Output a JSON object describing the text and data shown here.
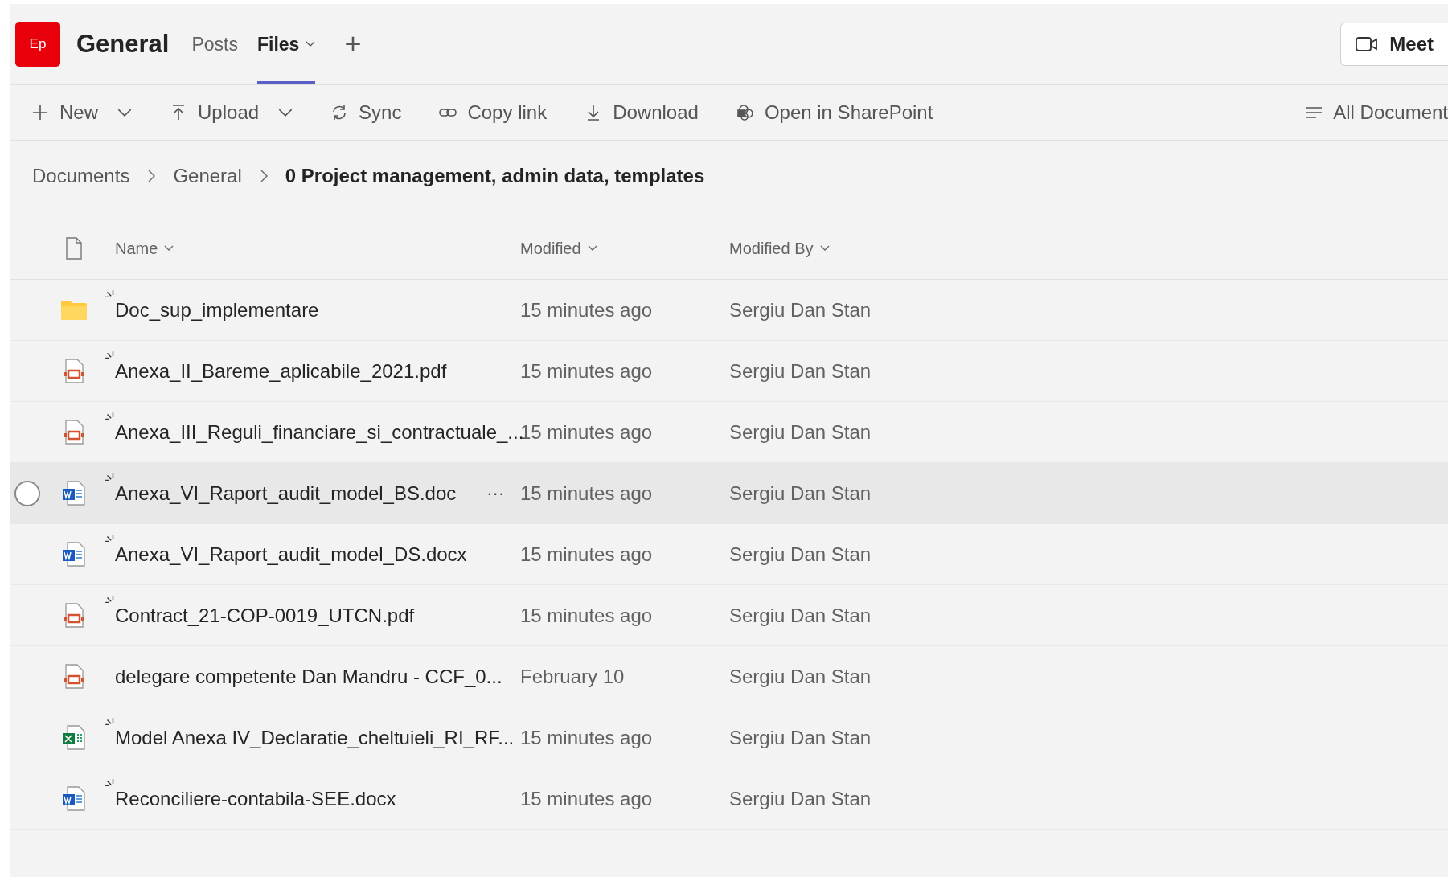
{
  "header": {
    "team_initials": "Ep",
    "channel": "General",
    "tabs": [
      {
        "label": "Posts",
        "selected": false,
        "dropdown": false
      },
      {
        "label": "Files",
        "selected": true,
        "dropdown": true
      }
    ],
    "add_tab": "+",
    "meet_button": "Meet"
  },
  "toolbar": {
    "actions": [
      {
        "label": "New",
        "kind": "new",
        "dropdown": true
      },
      {
        "label": "Upload",
        "kind": "upload",
        "dropdown": true
      },
      {
        "label": "Sync",
        "kind": "sync",
        "dropdown": false
      },
      {
        "label": "Copy link",
        "kind": "link",
        "dropdown": false
      },
      {
        "label": "Download",
        "kind": "download",
        "dropdown": false
      },
      {
        "label": "Open in SharePoint",
        "kind": "sharepoint",
        "dropdown": false
      }
    ],
    "view": "All Document"
  },
  "breadcrumb": [
    "Documents",
    "General",
    "0 Project management, admin data, templates"
  ],
  "table": {
    "columns": [
      "Name",
      "Modified",
      "Modified By"
    ],
    "more_label": "···",
    "rows": [
      {
        "kind": "folder",
        "name": "Doc_sup_implementare",
        "new": true,
        "hovered": false,
        "modified": "15 minutes ago",
        "modified_by": "Sergiu Dan Stan"
      },
      {
        "kind": "pdf",
        "name": "Anexa_II_Bareme_aplicabile_2021.pdf",
        "new": true,
        "hovered": false,
        "modified": "15 minutes ago",
        "modified_by": "Sergiu Dan Stan"
      },
      {
        "kind": "pdf",
        "name": "Anexa_III_Reguli_financiare_si_contractuale_...",
        "new": true,
        "hovered": false,
        "modified": "15 minutes ago",
        "modified_by": "Sergiu Dan Stan"
      },
      {
        "kind": "word",
        "name": "Anexa_VI_Raport_audit_model_BS.doc",
        "new": true,
        "hovered": true,
        "modified": "15 minutes ago",
        "modified_by": "Sergiu Dan Stan"
      },
      {
        "kind": "word",
        "name": "Anexa_VI_Raport_audit_model_DS.docx",
        "new": true,
        "hovered": false,
        "modified": "15 minutes ago",
        "modified_by": "Sergiu Dan Stan"
      },
      {
        "kind": "pdf",
        "name": "Contract_21-COP-0019_UTCN.pdf",
        "new": true,
        "hovered": false,
        "modified": "15 minutes ago",
        "modified_by": "Sergiu Dan Stan"
      },
      {
        "kind": "pdf",
        "name": "delegare competente Dan Mandru - CCF_0...",
        "new": false,
        "hovered": false,
        "modified": "February 10",
        "modified_by": "Sergiu Dan Stan"
      },
      {
        "kind": "excel",
        "name": "Model Anexa IV_Declaratie_cheltuieli_RI_RF...",
        "new": true,
        "hovered": false,
        "modified": "15 minutes ago",
        "modified_by": "Sergiu Dan Stan"
      },
      {
        "kind": "word",
        "name": "Reconciliere-contabila-SEE.docx",
        "new": true,
        "hovered": false,
        "modified": "15 minutes ago",
        "modified_by": "Sergiu Dan Stan"
      }
    ]
  }
}
